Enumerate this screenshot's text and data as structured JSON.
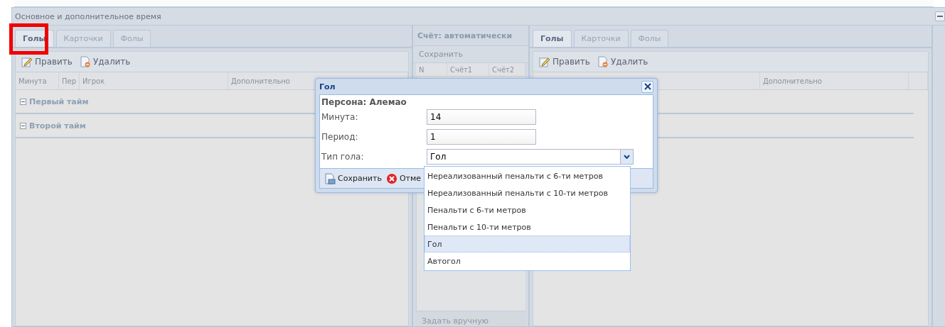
{
  "window": {
    "title": "Основное и дополнительное время"
  },
  "left_panel": {
    "tabs": [
      {
        "label": "Голы",
        "selected": true
      },
      {
        "label": "Карточки",
        "selected": false
      },
      {
        "label": "Фолы",
        "selected": false
      }
    ],
    "toolbar": [
      "Править",
      "Удалить"
    ],
    "columns": [
      "Минута",
      "Пер",
      "Игрок",
      "Дополнительно"
    ],
    "groups": [
      {
        "label": "Первый тайм",
        "expanded": true
      },
      {
        "label": "Второй тайм",
        "expanded": true
      }
    ]
  },
  "score_panel": {
    "title": "Счёт: автоматически",
    "save_button": {
      "label": "Сохранить",
      "disabled": true
    },
    "columns": [
      "N",
      "Счёт1",
      "Счёт2"
    ],
    "footer_button": "Задать вручную"
  },
  "right_panel": {
    "tabs": [
      {
        "label": "Голы",
        "selected": true
      },
      {
        "label": "Карточки",
        "selected": false
      },
      {
        "label": "Фолы",
        "selected": false
      }
    ],
    "toolbar": [
      "Править",
      "Удалить"
    ],
    "columns": [
      "Дополнительно"
    ]
  },
  "dialog": {
    "title": "Гол",
    "person": "Персона: Алемао",
    "fields": [
      {
        "kind": "text",
        "label": "Минута:",
        "value": "14"
      },
      {
        "kind": "text",
        "label": "Период:",
        "value": "1"
      },
      {
        "kind": "combo",
        "label": "Тип гола:",
        "value": "Гол"
      }
    ],
    "buttons": [
      {
        "kind": "save",
        "label": "Сохранить"
      },
      {
        "kind": "cancel",
        "label": "Отме"
      }
    ],
    "dropdown": [
      {
        "label": "Нереализованный пенальти с 6-ти метров",
        "selected": false
      },
      {
        "label": "Нереализованный пенальти с 10-ти метров",
        "selected": false
      },
      {
        "label": "Пенальти с 6-ти метров",
        "selected": false
      },
      {
        "label": "Пенальти с 10-ти метров",
        "selected": false
      },
      {
        "label": "Гол",
        "selected": true
      },
      {
        "label": "Автогол",
        "selected": false
      }
    ]
  }
}
